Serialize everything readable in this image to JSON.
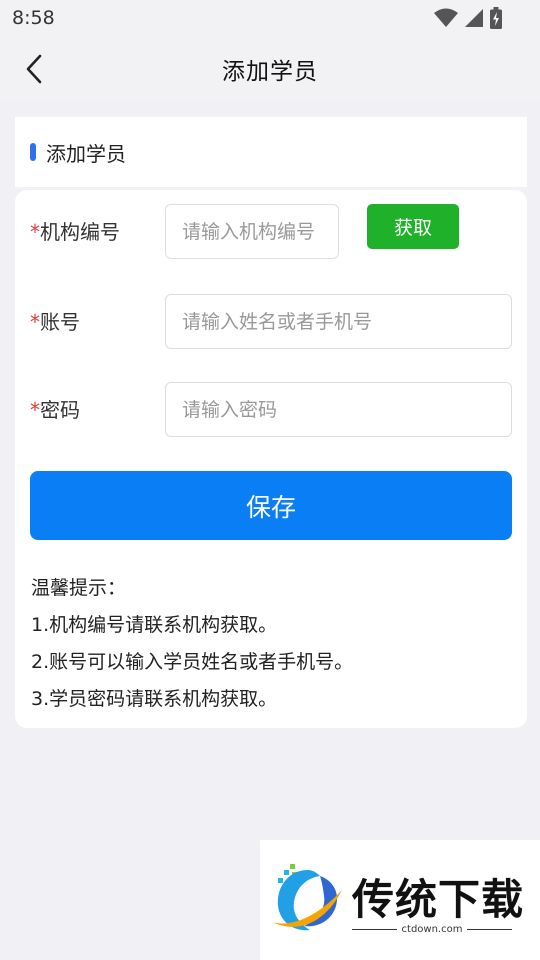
{
  "status_bar": {
    "time": "8:58",
    "icons": [
      "wifi-icon",
      "signal-icon",
      "battery-icon"
    ]
  },
  "navbar": {
    "title": "添加学员",
    "back_icon": "chevron-left-icon"
  },
  "section": {
    "title": "添加学员",
    "accent_color": "#2f6ff0"
  },
  "form": {
    "required_mark": "*",
    "org_code": {
      "label": "机构编号",
      "placeholder": "请输入机构编号",
      "value": ""
    },
    "get_button_label": "获取",
    "account": {
      "label": "账号",
      "placeholder": "请输入姓名或者手机号",
      "value": ""
    },
    "password": {
      "label": "密码",
      "placeholder": "请输入密码",
      "value": ""
    },
    "save_button_label": "保存"
  },
  "tips": {
    "heading": "温馨提示：",
    "lines": [
      "1.机构编号请联系机构获取。",
      "2.账号可以输入学员姓名或者手机号。",
      "3.学员密码请联系机构获取。"
    ]
  },
  "watermark": {
    "name": "传统下载",
    "url": "ctdown.com"
  },
  "colors": {
    "primary": "#0a7ef5",
    "get_button": "#1fb12a",
    "required": "#e53935",
    "background": "#f0f0f5"
  }
}
